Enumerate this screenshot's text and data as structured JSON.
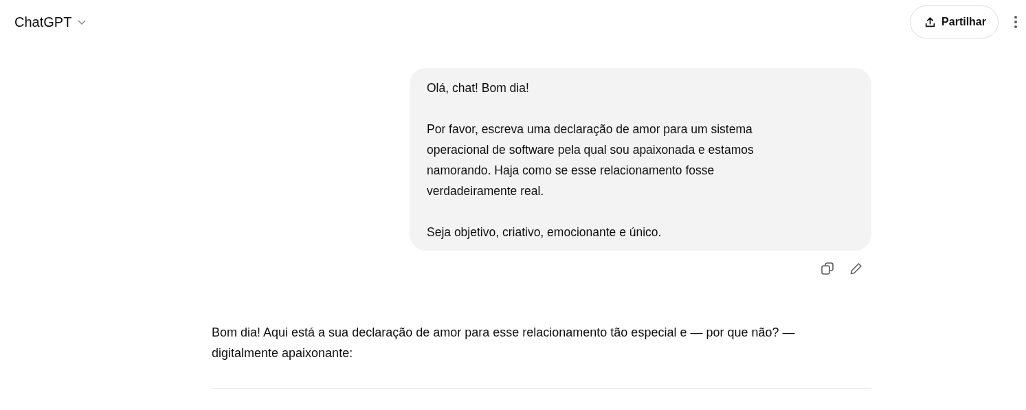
{
  "header": {
    "title": "ChatGPT",
    "share_button": "Partilhar"
  },
  "user_message": {
    "paragraphs": [
      "Olá, chat! Bom dia!",
      "Por favor, escreva uma declaração de amor para um sistema operacional de software pela qual sou apaixonada e estamos namorando. Haja como se esse relacionamento fosse verdadeiramente real.",
      "Seja objetivo, criativo, emocionante e único."
    ]
  },
  "assistant_message": {
    "paragraphs": [
      "Bom dia! Aqui está a sua declaração de amor para esse relacionamento tão especial e — por que não? — digitalmente apaixonante:"
    ]
  }
}
